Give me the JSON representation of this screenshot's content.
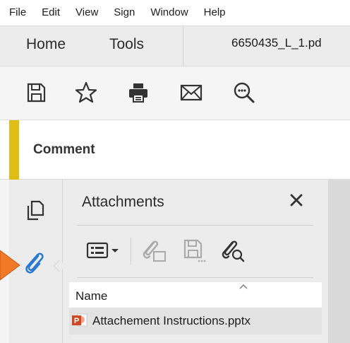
{
  "menu": {
    "items": [
      "File",
      "Edit",
      "View",
      "Sign",
      "Window",
      "Help"
    ]
  },
  "tabs": {
    "home": "Home",
    "tools": "Tools",
    "document": "6650435_L_1.pd"
  },
  "toolbar": {
    "icons": [
      "save-icon",
      "bookmark-star-icon",
      "print-icon",
      "email-icon",
      "zoom-search-icon"
    ]
  },
  "comment_bar": {
    "label": "Comment",
    "accent_color": "#dfbd16"
  },
  "rail": {
    "icons": [
      "page-thumbnails-icon",
      "attachments-paperclip-icon"
    ],
    "active_color": "#2a7ad4",
    "callout_color": "#f07a28"
  },
  "attachments_panel": {
    "title": "Attachments",
    "tools": [
      "options-menu-icon",
      "add-file-icon",
      "save-attachment-icon",
      "search-attachment-icon"
    ],
    "column_header": "Name",
    "files": [
      {
        "name": "Attachement Instructions.pptx",
        "icon": "powerpoint-file-icon"
      }
    ]
  }
}
